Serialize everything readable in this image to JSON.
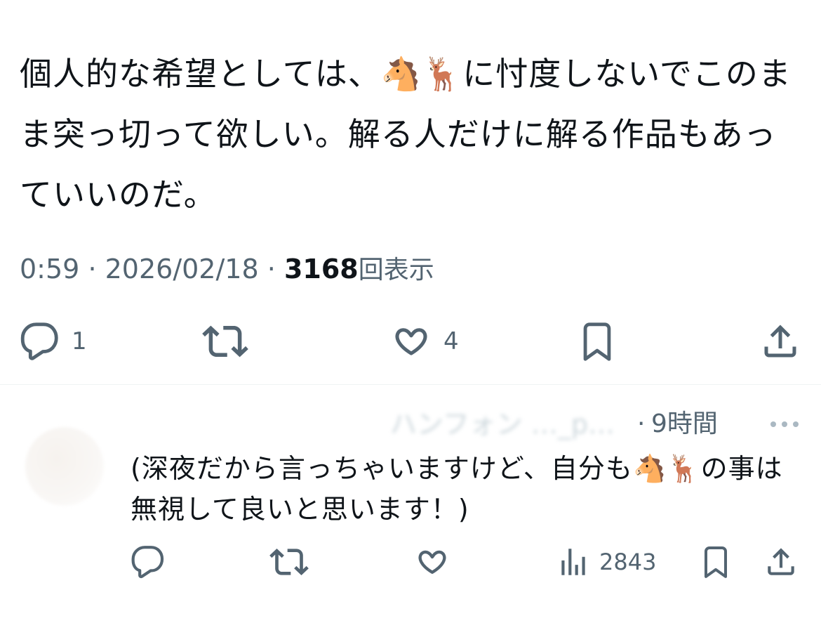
{
  "tweet": {
    "text_part1": "個人的な希望としては、",
    "emoji1": "🐴",
    "emoji2": "🦌",
    "text_part2": "に忖度しないでこのまま突っ切って欲しい。解る人だけに解る作品もあっていいのだ。",
    "time": "0:59",
    "date": "2026/02/18",
    "separator": "·",
    "views_count": "3168",
    "views_label": "回表示",
    "actions": {
      "reply_count": "1",
      "retweet_count": "",
      "like_count": "4"
    }
  },
  "reply": {
    "name_blurred": "ハンフォン",
    "handle_truncated": "…_p…",
    "separator": "·",
    "time": "9時間",
    "text_part1": "(深夜だから言っちゃいますけど、自分も",
    "emoji1": "🐴",
    "emoji2": "🦌",
    "text_part2": "の事は無視して良いと思います！)",
    "actions": {
      "views_count": "2843"
    }
  },
  "icons": {
    "reply": "reply-icon",
    "retweet": "retweet-icon",
    "like": "heart-icon",
    "bookmark": "bookmark-icon",
    "share": "share-icon",
    "views": "views-icon",
    "more": "more-icon"
  },
  "colors": {
    "text": "#0f1419",
    "secondary": "#536471",
    "divider": "#eff3f4"
  }
}
